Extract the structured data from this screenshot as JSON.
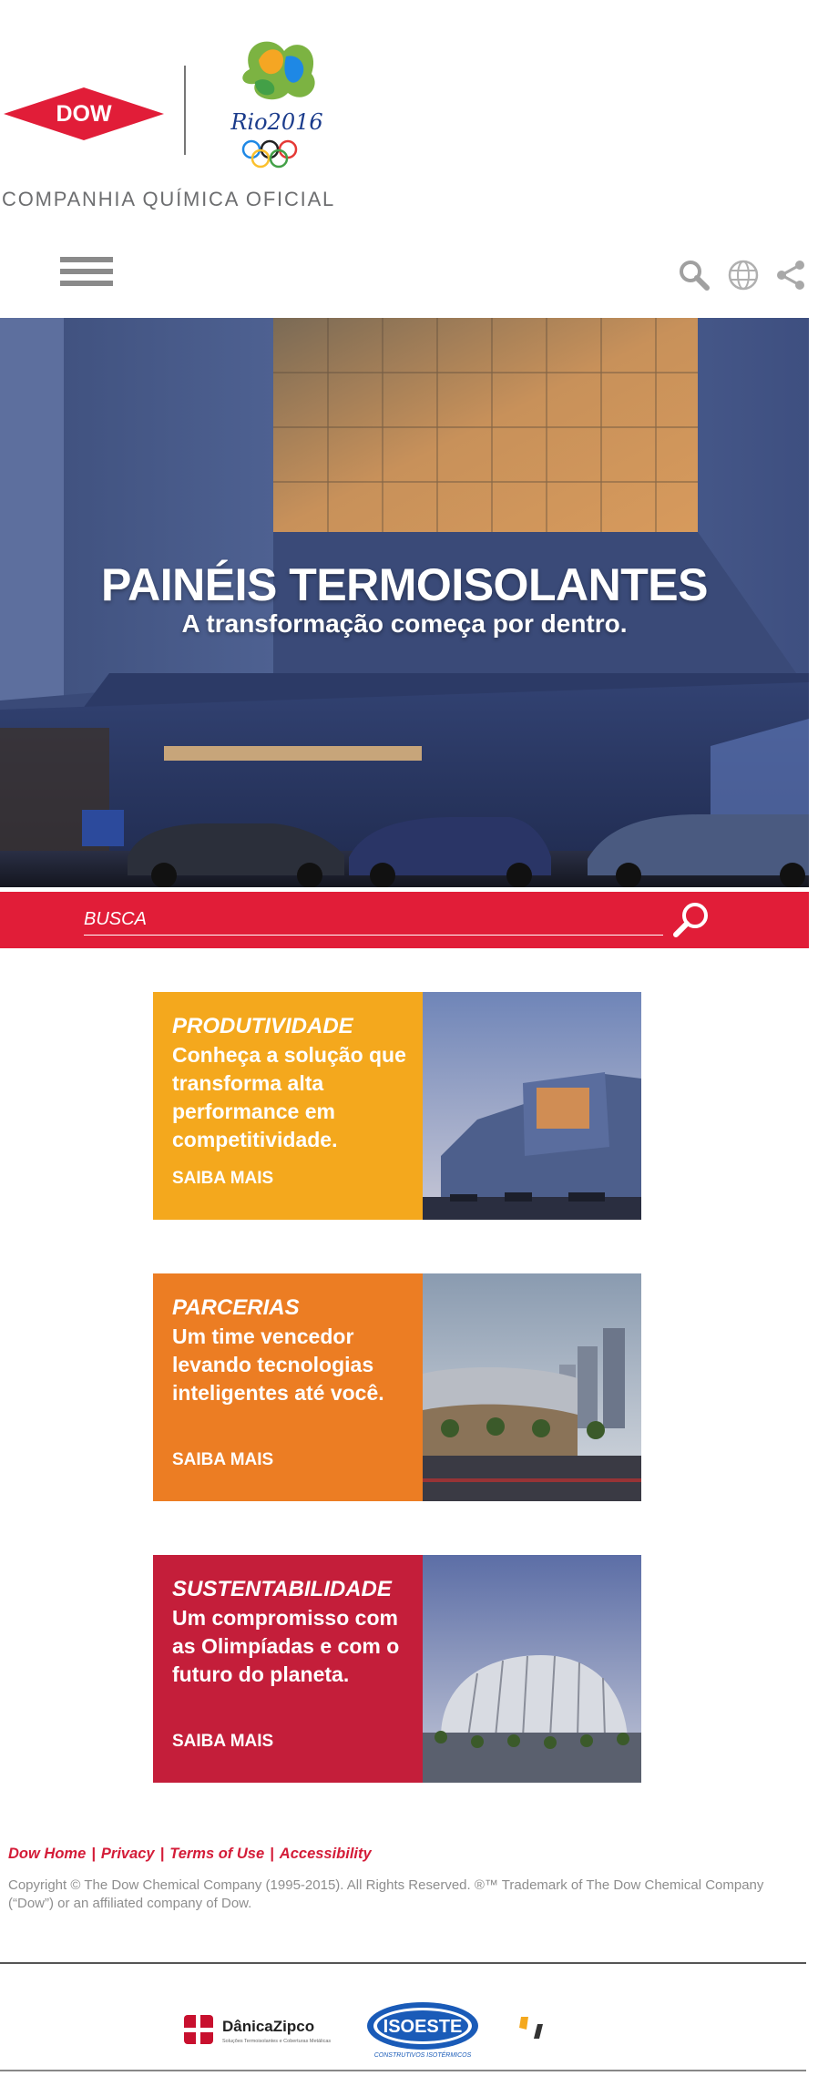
{
  "header": {
    "brand_logo_text": "DOW",
    "olympic_logo_text": "Rio2016",
    "tagline": "COMPANHIA QUÍMICA OFICIAL"
  },
  "toolbar": {
    "icons": [
      "menu-icon",
      "search-icon",
      "globe-icon",
      "share-icon"
    ]
  },
  "hero": {
    "title": "PAINÉIS TERMOISOLANTES",
    "subtitle": "A transformação começa por dentro."
  },
  "search": {
    "placeholder": "BUSCA"
  },
  "cards": [
    {
      "title": "PRODUTIVIDADE",
      "text": "Conheça a solução que transforma alta performance em competitividade.",
      "link": "SAIBA MAIS",
      "color": "#f4a81d"
    },
    {
      "title": "PARCERIAS",
      "text": "Um time vencedor levando tecnologias inteligentes até você.",
      "link": "SAIBA MAIS",
      "color": "#ec7d23"
    },
    {
      "title": "SUSTENTABILIDADE",
      "text": "Um compromisso com as Olimpíadas e com o futuro do planeta.",
      "link": "SAIBA MAIS",
      "color": "#c41e3a"
    }
  ],
  "footer": {
    "links": [
      "Dow Home",
      "Privacy",
      "Terms of Use",
      "Accessibility"
    ],
    "separator": "|",
    "copyright": "Copyright © The Dow Chemical Company (1995-2015). All Rights Reserved.    ®™ Trademark of The Dow Chemical Company (“Dow”) or an affiliated company of Dow."
  },
  "partners": [
    {
      "name": "DânicaZipco",
      "subtitle": "Soluções Termoisolantes e Coberturas Metálicas"
    },
    {
      "name": "ISOESTE",
      "subtitle": "CONSTRUTIVOS ISOTÉRMICOS"
    }
  ],
  "colors": {
    "brand_red": "#e11d38",
    "link_red": "#d41c38",
    "gray_text": "#6d6e70",
    "hero_blue": "#4a5a86"
  }
}
